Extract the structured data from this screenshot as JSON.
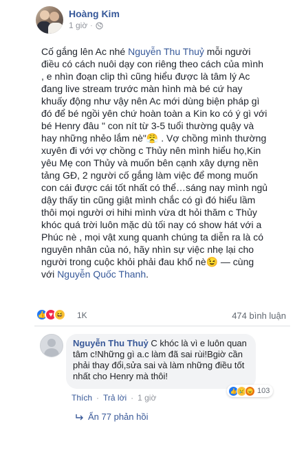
{
  "post": {
    "author": "Hoàng Kim",
    "time": "1 giờ",
    "dot": "·",
    "privacy_icon": "globe-icon",
    "text": {
      "p1_before": "Cố gắng lên Ac nhé ",
      "mention1": "Nguyễn Thu Thuỷ",
      "p1_after": " mỗi người điều có cách nuôi dạy con riêng theo cách của mình , e nhìn đoạn clip thì cũng hiểu được là tâm lý Ac đang live stream trước màn hình mà bé cứ hay khuấy động như vậy nên Ac mới dùng biện pháp gì đó để bé ngồi yên chứ hoàn toàn a Kin ko có ý gì với bé Henry đâu \" con nít từ 3-5 tuổi thường quậy và hay những nhẻo lắm nè\"😤 . Vợ chồng mình thường xuyên đi với vợ chồng c Thủy nên mình hiểu họ,Kin yêu Mẹ con Thủy và muốn bên cạnh xây dựng nền tảng GĐ, 2 người cố gắng làm việc để mong muốn con cái được cái tốt nhất có thể…sáng nay mình ngủ dậy thấy tin cũng giật mình chắc có gì đó hiểu lầm thôi mọi người ơi hihi mình vừa dt hỏi thăm c Thủy khóc quá trời luôn mặc dù tối nay có show hát với a Phúc nè , mọi vật xung quanh chúng ta diễn ra là có nguyên nhân của nó, hãy nhìn sự việc nhẹ lại cho người trong cuộc khỏi phải đau khổ nè😉 — cùng với ",
      "mention2": "Nguyễn Quốc Thanh",
      "end": "."
    },
    "reactions": {
      "icons": [
        "like-icon",
        "love-icon",
        "haha-icon"
      ],
      "count": "1K"
    },
    "comments_count": "474 bình luận"
  },
  "comment": {
    "author": "Nguyễn Thu Thuỷ",
    "text": "C khóc là vì e luôn quan tâm c!Những gì a.c làm đã sai rùi!Bgiờ cần phải thay đổi,sửa sai và làm những điều tốt nhất cho Henry mà thôi!",
    "actions": {
      "like": "Thích",
      "sep": "·",
      "reply": "Trả lời",
      "time": "1 giờ"
    },
    "reactions": {
      "icons": [
        "like-icon",
        "sad-icon",
        "angry-icon"
      ],
      "count": "103"
    },
    "replies_label": "Ẩn 77 phản hồi",
    "replies_icon": "reply-arrow-icon"
  },
  "colors": {
    "link": "#365899",
    "like": "#2078f4",
    "love": "#f0284a",
    "haha": "#fcc440",
    "angry": "#e9710f"
  }
}
